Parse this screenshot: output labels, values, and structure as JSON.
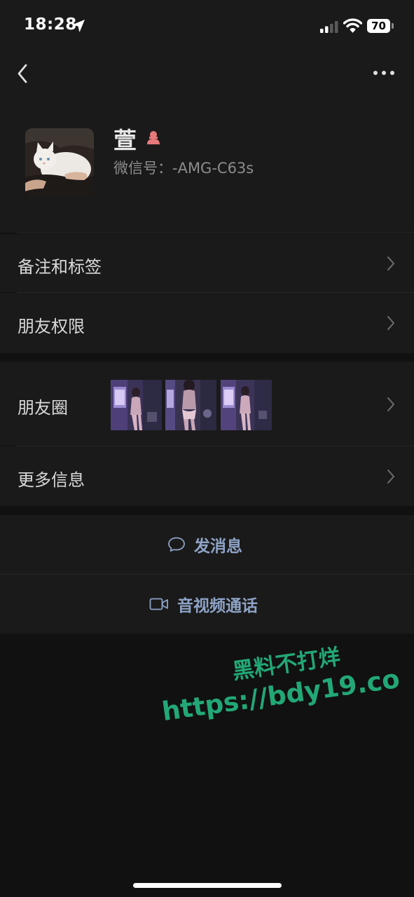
{
  "status_bar": {
    "time": "18:28",
    "battery": "70"
  },
  "profile": {
    "name": "萱",
    "wechat_id": "微信号：-AMG-C63s",
    "gender_icon": "female-icon",
    "accent_female": "#e8797b"
  },
  "list": {
    "remark_tags": "备注和标签",
    "friend_permissions": "朋友权限",
    "moments": "朋友圈",
    "more_info": "更多信息"
  },
  "actions": {
    "send_message": "发消息",
    "video_call": "音视频通话",
    "action_color": "#8ea3c6"
  },
  "watermark": {
    "line1": "黑料不打烊",
    "line2": "https://bdy19.co",
    "color": "#22a876"
  }
}
